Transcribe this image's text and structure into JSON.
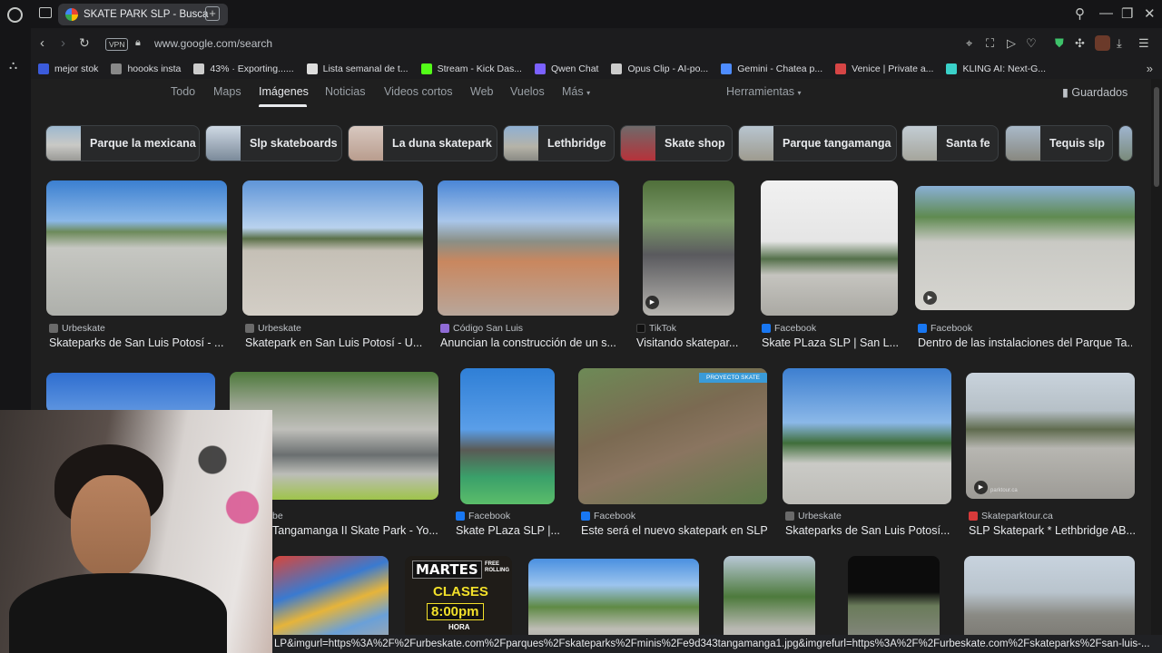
{
  "tab": {
    "title": "SKATE PARK SLP - Busca"
  },
  "address": {
    "vpn_label": "VPN",
    "url": "www.google.com/search"
  },
  "bookmarks": [
    {
      "label": "mejor stok",
      "color": "#3b5bdb"
    },
    {
      "label": "hoooks insta",
      "color": "#888888"
    },
    {
      "label": "43% · Exporting......",
      "color": "#cccccc"
    },
    {
      "label": "Lista semanal de t...",
      "color": "#dddddd"
    },
    {
      "label": "Stream - Kick Das...",
      "color": "#53fc18"
    },
    {
      "label": "Qwen Chat",
      "color": "#7b61ff"
    },
    {
      "label": "Opus Clip - AI-po...",
      "color": "#cccccc"
    },
    {
      "label": "Gemini - Chatea p...",
      "color": "#4e8cff"
    },
    {
      "label": "Venice | Private a...",
      "color": "#d64545"
    },
    {
      "label": "KLING AI: Next-G...",
      "color": "#3ad1c9"
    }
  ],
  "search_tabs": [
    "Todo",
    "Maps",
    "Imágenes",
    "Noticias",
    "Videos cortos",
    "Web",
    "Vuelos",
    "Más"
  ],
  "tools_label": "Herramientas",
  "saved_label": "Guardados",
  "chips": [
    "Parque la mexicana",
    "Slp skateboards",
    "La duna skatepark",
    "Lethbridge",
    "Skate shop",
    "Parque tangamanga",
    "Santa fe",
    "Tequis slp"
  ],
  "row1": [
    {
      "source": "Urbeskate",
      "title": "Skateparks de San Luis Potosí - ..."
    },
    {
      "source": "Urbeskate",
      "title": "Skatepark en San Luis Potosí - U..."
    },
    {
      "source": "Código San Luis",
      "title": "Anuncian la construcción de un s..."
    },
    {
      "source": "TikTok",
      "title": "Visitando skatepar..."
    },
    {
      "source": "Facebook",
      "title": "Skate PLaza SLP | San L..."
    },
    {
      "source": "Facebook",
      "title": "Dentro de las instalaciones del Parque Ta..."
    }
  ],
  "row2": [
    {
      "source": "be",
      "title": "Tangamanga II Skate Park - Yo..."
    },
    {
      "source": "Facebook",
      "title": "Skate PLaza SLP |..."
    },
    {
      "source": "Facebook",
      "title": "Este será el nuevo skatepark en SLP"
    },
    {
      "source": "Urbeskate",
      "title": "Skateparks de San Luis Potosí..."
    },
    {
      "source": "Skateparktour.ca",
      "title": "SLP Skatepark * Lethbridge AB..."
    }
  ],
  "overlays": {
    "proyecto": "PROYECTO SKATE",
    "martes": "MARTES",
    "clases": "CLASES",
    "time": "8:00pm",
    "hora": "HORA",
    "free": "FREE ROLLING",
    "watermark": "parktour.ca"
  },
  "status_url": "LP&imgurl=https%3A%2F%2Furbeskate.com%2Fparques%2Fskateparks%2Fminis%2Fe9d343tangamanga1.jpg&imgrefurl=https%3A%2F%2Furbeskate.com%2Fskateparks%2Fsan-luis-..."
}
